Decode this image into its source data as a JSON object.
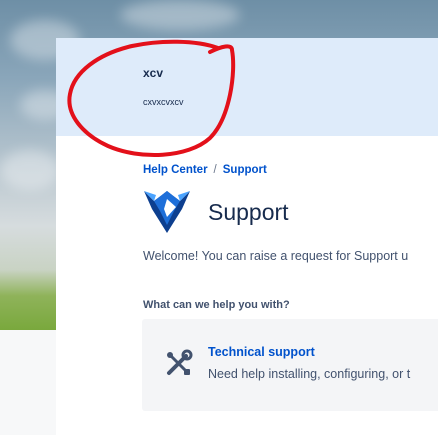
{
  "banner": {
    "title": "xcv",
    "subtitle": "cxvxcvxcv"
  },
  "breadcrumb": {
    "home": "Help Center",
    "separator": "/",
    "current": "Support"
  },
  "page": {
    "title": "Support",
    "welcome": "Welcome! You can raise a request for Support u",
    "question": "What can we help you with?"
  },
  "request_types": [
    {
      "title": "Technical support",
      "description": "Need help installing, configuring, or t",
      "icon": "tools-icon"
    }
  ],
  "colors": {
    "link": "#0052cc",
    "text": "#172b4d",
    "banner_bg": "#deebfa",
    "annotation": "#e3101a"
  }
}
